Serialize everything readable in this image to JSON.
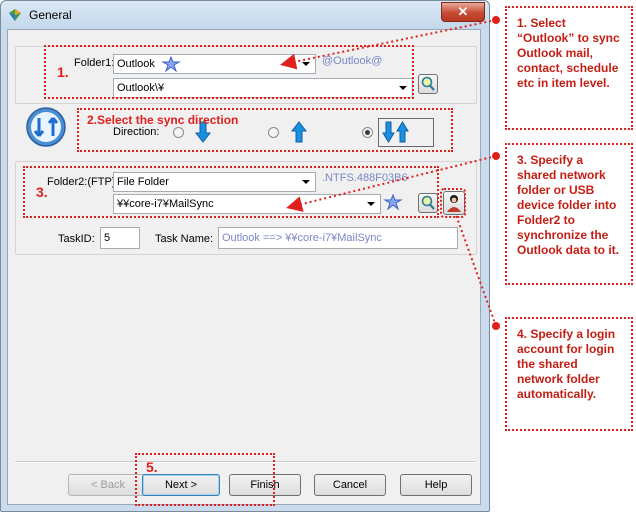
{
  "window": {
    "title": "General",
    "close_glyph": "✕"
  },
  "folder1": {
    "label": "Folder1:",
    "type_value": "Outlook",
    "hint": "@Outlook@",
    "path_value": "Outlook\\¥"
  },
  "direction": {
    "label": "Direction:",
    "selected": "two-way"
  },
  "folder2": {
    "label": "Folder2:(FTP)",
    "type_value": "File Folder",
    "hint": ".NTFS.488F03B6",
    "path_value": "¥¥core-i7¥MailSync"
  },
  "task": {
    "id_label": "TaskID:",
    "id_value": "5",
    "name_label": "Task Name:",
    "name_value": "Outlook ==> ¥¥core-i7¥MailSync"
  },
  "buttons": {
    "back": "< Back",
    "next": "Next >",
    "finish": "Finish",
    "cancel": "Cancel",
    "help": "Help"
  },
  "annotations": {
    "step1": "1.",
    "step2": "2.Select the sync direction",
    "step3": "3.",
    "step5": "5.",
    "callout1": "1. Select “Outlook” to sync Outlook mail, contact, schedule etc in item level.",
    "callout3": "3. Specify a shared network folder or USB device folder into Folder2 to synchronize the Outlook data to it.",
    "callout4": "4. Specify a login account for login the shared network folder automatically."
  },
  "colors": {
    "annotation": "#e0201c",
    "callout_text": "#c41e14",
    "hint_text": "#7b86c7",
    "arrow_blue": "#1a8fe0"
  }
}
